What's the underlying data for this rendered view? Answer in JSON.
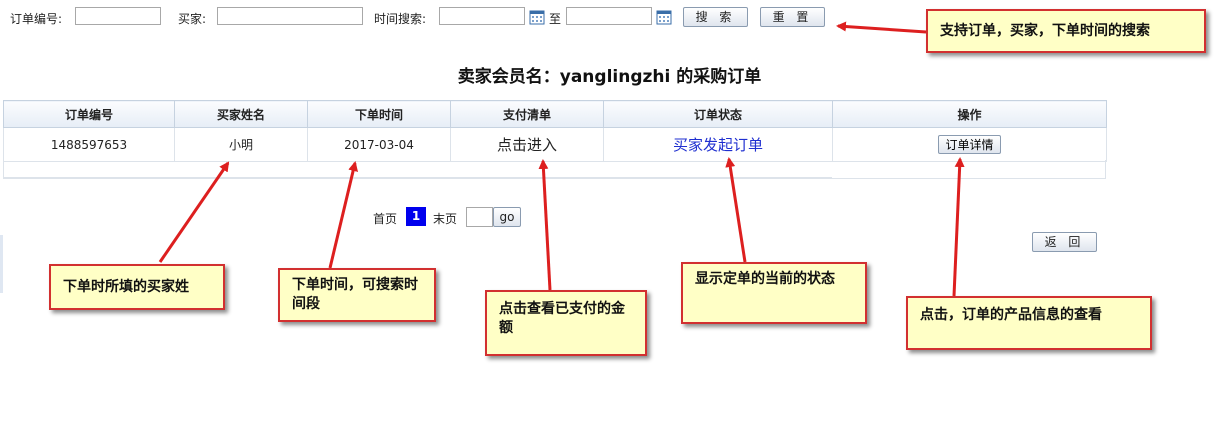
{
  "search": {
    "order_no_label": "订单编号:",
    "buyer_label": "买家:",
    "time_label": "时间搜索:",
    "to_label": "至",
    "search_button": "搜 索",
    "reset_button": "重 置",
    "order_no_value": "",
    "buyer_value": "",
    "time_from_value": "",
    "time_to_value": ""
  },
  "page_title": "卖家会员名：yanglingzhi 的采购订单",
  "table": {
    "headers": [
      "订单编号",
      "买家姓名",
      "下单时间",
      "支付清单",
      "订单状态",
      "操作"
    ],
    "rows": [
      {
        "order_no": "1488597653",
        "buyer_name": "小明",
        "order_time": "2017-03-04",
        "payment_link": "点击进入",
        "status": "买家发起订单",
        "action_button": "订单详情"
      }
    ]
  },
  "pager": {
    "first": "首页",
    "current": "1",
    "last": "末页",
    "goto_value": "",
    "go_button": "go"
  },
  "back_button": "返 回",
  "notes": {
    "search_note": "支持订单，买家，下单时间的搜索",
    "buyer_note": "下单时所填的买家姓",
    "time_note": "下单时间，可搜索时间段",
    "payment_note": "点击查看已支付的金额",
    "status_note": "显示定单的当前的状态",
    "detail_note": "点击，订单的产品信息的查看"
  },
  "colors": {
    "note_bg": "#ffffc6",
    "arrow": "#dd1f1f",
    "status_text": "#1f2fd0",
    "pager_current": "#0000ee"
  }
}
